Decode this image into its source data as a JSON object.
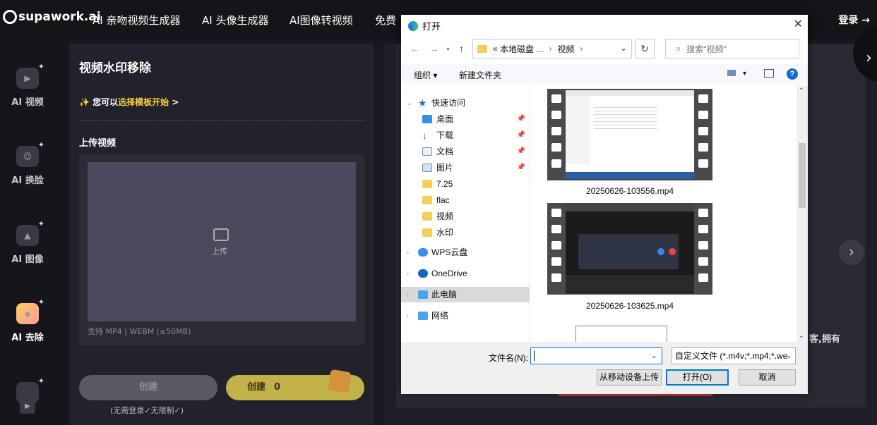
{
  "header": {
    "logo": "supawork.ai",
    "nav": [
      "AI 亲吻视频生成器",
      "AI 头像生成器",
      "AI图像转视频",
      "免费"
    ],
    "login": "登录 →"
  },
  "sidebar": {
    "items": [
      {
        "label": "AI 视频",
        "icon": "video-icon"
      },
      {
        "label": "AI 换脸",
        "icon": "face-swap-icon"
      },
      {
        "label": "AI 图像",
        "icon": "image-icon"
      },
      {
        "label": "AI 去除",
        "icon": "eraser-icon"
      }
    ]
  },
  "panel": {
    "title": "视频水印移除",
    "template_prefix": "您可以",
    "template_link": "选择模板开始",
    "template_suffix": " >",
    "upload_label": "上传视频",
    "upload_text": "上传",
    "support_text": "支持 MP4 | WEBM (≤50MB)",
    "create_label": "创建",
    "create_paid_label": "创建",
    "create_paid_count": "0",
    "note": "(无需登录✓无限制✓)"
  },
  "right": {
    "text": "客,拥有",
    "arrow": "›"
  },
  "dialog": {
    "title": "打开",
    "address": {
      "parts": [
        "«",
        "本地磁盘 ...",
        "视频"
      ]
    },
    "search_placeholder": "搜索\"视频\"",
    "toolbar": {
      "organize": "组织 ▾",
      "new_folder": "新建文件夹",
      "help": "?"
    },
    "tree": [
      {
        "label": "快速访问",
        "type": "star",
        "indent": 0,
        "pinned": false
      },
      {
        "label": "桌面",
        "type": "desktop",
        "indent": 1,
        "pinned": true
      },
      {
        "label": "下载",
        "type": "download",
        "indent": 1,
        "pinned": true
      },
      {
        "label": "文档",
        "type": "doc",
        "indent": 1,
        "pinned": true
      },
      {
        "label": "图片",
        "type": "pic",
        "indent": 1,
        "pinned": true
      },
      {
        "label": "7.25",
        "type": "folder",
        "indent": 1,
        "pinned": false
      },
      {
        "label": "flac",
        "type": "folder",
        "indent": 1,
        "pinned": false
      },
      {
        "label": "视频",
        "type": "folder",
        "indent": 1,
        "pinned": false
      },
      {
        "label": "水印",
        "type": "folder",
        "indent": 1,
        "pinned": false
      },
      {
        "label": "WPS云盘",
        "type": "cloud",
        "indent": 0,
        "pinned": false
      },
      {
        "label": "OneDrive",
        "type": "cloud",
        "indent": 0,
        "pinned": false
      },
      {
        "label": "此电脑",
        "type": "pc",
        "indent": 0,
        "pinned": false,
        "selected": true
      },
      {
        "label": "网络",
        "type": "net",
        "indent": 0,
        "pinned": false
      }
    ],
    "files": [
      {
        "name": "20250626-103556.mp4"
      },
      {
        "name": "20250626-103625.mp4"
      }
    ],
    "filename_label": "文件名(N):",
    "filename_value": "",
    "filetype": "自定义文件 (*.m4v;*.mp4;*.we",
    "btn_mobile": "从移动设备上传",
    "btn_open": "打开(O)",
    "btn_cancel": "取消"
  }
}
